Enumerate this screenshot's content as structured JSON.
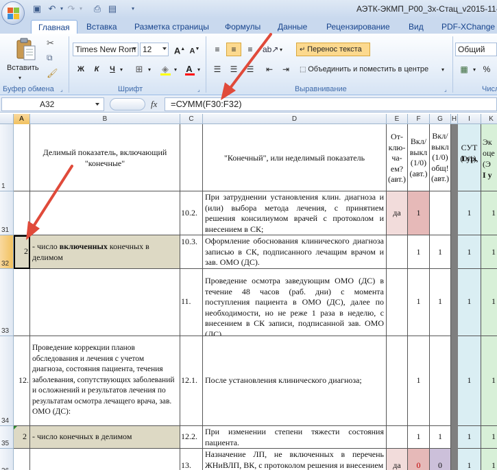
{
  "window": {
    "title": "АЭТК-ЭКМП_Р00_3х-Стац_v2015-11-09"
  },
  "tabs": [
    "Главная",
    "Вставка",
    "Разметка страницы",
    "Формулы",
    "Данные",
    "Рецензирование",
    "Вид",
    "PDF-XChange 20"
  ],
  "ribbon": {
    "paste_label": "Вставить",
    "font_name": "Times New Rom",
    "font_size": "12",
    "bold": "Ж",
    "italic": "К",
    "underline": "Ч",
    "wrap_text": "Перенос текста",
    "merge_center": "Объединить и поместить в центре",
    "number_format": "Общий",
    "percent": "%",
    "groups": {
      "clipboard": "Буфер обмена",
      "font": "Шрифт",
      "alignment": "Выравнивание",
      "number": "Числ"
    }
  },
  "formula_bar": {
    "name_box": "A32",
    "fx": "fx",
    "formula": "=СУММ(F30:F32)"
  },
  "columns": [
    "A",
    "B",
    "C",
    "D",
    "E",
    "F",
    "G",
    "H",
    "I",
    "K"
  ],
  "headers": {
    "b": "Делимый показатель, включающий \"конечные\"",
    "d": "\"Конечный\", или неделимый показатель",
    "e": "От-клю-ча-ем? (авт.)",
    "f": "Вкл/ выкл (1/0) (авт.)",
    "g": "Вкл/ выкл (1/0) общ! (авт.)",
    "i_line1": "СУТ (0/1),",
    "i_line2": "I ур.",
    "k_line1": "Эк",
    "k_line2": "оце",
    "k_line3": "(Э",
    "k_line4": "I у"
  },
  "rows": [
    {
      "num": "1"
    },
    {
      "num": "31",
      "c": "10.2.",
      "d": "При затруднении установления клин. диагноза и (или) выбора метода лечения, с принятием решения консилиумом врачей с протоколом и внесением в СК;",
      "e": "да",
      "f": "1",
      "i": "1",
      "k": "1"
    },
    {
      "num": "32",
      "a": "2",
      "b_prefix": "- число ",
      "b_bold": "включенных",
      "b_suffix": " конечных в делимом",
      "c": "10.3.",
      "d": "Оформление обоснования клинического диагноза записью в СК, подписанного лечащим врачом и зав. ОМО (ДС).",
      "f": "1",
      "g": "1",
      "i": "1",
      "k": "1"
    },
    {
      "num": "33",
      "c": "11.",
      "d": "Проведение осмотра заведующим ОМО (ДС) в течение 48 часов (раб. дни) с момента поступления пациента в ОМО (ДС), далее по необходимости, но не реже 1 раза в неделю, с внесением в СК записи, подписанной зав. ОМО (ДС).",
      "f": "1",
      "g": "1",
      "i": "1",
      "k": "1"
    },
    {
      "num": "34",
      "a": "12.",
      "b": "Проведение коррекции планов обследования и лечения с учетом диагноза, состояния пациента, течения заболевания, сопутствующих заболеваний и осложнений и результатов лечения по результатам осмотра лечащего врача, зав. ОМО (ДС):",
      "c": "12.1.",
      "d": "После установления клинического диагноза;",
      "f": "1",
      "i": "1",
      "k": "1"
    },
    {
      "num": "35",
      "a": "2",
      "b": "- число конечных в делимом",
      "c": "12.2.",
      "d": "При изменении степени тяжести состояния пациента.",
      "f": "1",
      "g": "1",
      "i": "1",
      "k": "1"
    },
    {
      "num": "36",
      "c": "13.",
      "d": "Назначение ЛП, не включенных в перечень ЖНиВЛП, ВК, с протоколом решения и внесением",
      "e": "да",
      "f": "0",
      "g": "0",
      "i": "1",
      "k": "1"
    }
  ],
  "colors": {
    "pink": "#f2dcdb",
    "pink_dark": "#e6b9b8",
    "tan": "#ddd9c4",
    "lavender": "#ccc0da",
    "aqua": "#daeef3",
    "green_col": "#d8f0d8",
    "arrow": "#e04a3a"
  }
}
